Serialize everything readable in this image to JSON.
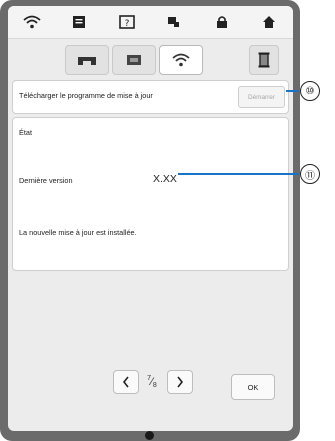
{
  "topbar": {
    "icons": [
      "wifi-icon",
      "page-icon",
      "help-icon",
      "settings-icon",
      "lock-icon",
      "home-icon"
    ]
  },
  "tabs": {
    "items": [
      {
        "icon": "machine-icon",
        "active": false
      },
      {
        "icon": "card-icon",
        "active": false
      },
      {
        "icon": "wifi-icon",
        "active": true
      }
    ],
    "square_icon": "frame-icon"
  },
  "update": {
    "download_label": "Télécharger le programme de mise à jour",
    "start_label": "Démarrer"
  },
  "status": {
    "title": "État",
    "version_label": "Dernière version",
    "version_value": "X.XX",
    "message": "La nouvelle mise à jour est installée."
  },
  "pager": {
    "current": "7",
    "total": "8"
  },
  "ok_label": "OK",
  "callouts": {
    "c10": "⑩",
    "c11": "⑪"
  },
  "colors": {
    "callout_line": "#1a73c8",
    "device_frame": "#6b6b6b"
  }
}
